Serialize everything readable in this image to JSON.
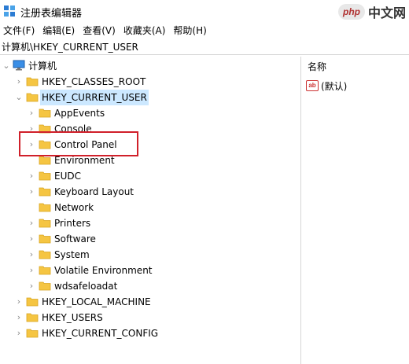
{
  "window": {
    "title": "注册表编辑器",
    "icon": "regedit-icon"
  },
  "watermark": {
    "badge": "php",
    "text": "中文网"
  },
  "menu": [
    {
      "label": "文件(F)"
    },
    {
      "label": "编辑(E)"
    },
    {
      "label": "查看(V)"
    },
    {
      "label": "收藏夹(A)"
    },
    {
      "label": "帮助(H)"
    }
  ],
  "address": "计算机\\HKEY_CURRENT_USER",
  "tree": {
    "root": {
      "label": "计算机",
      "expanded": true,
      "icon": "computer-icon"
    },
    "hives": [
      {
        "label": "HKEY_CLASSES_ROOT",
        "expanded": false
      },
      {
        "label": "HKEY_CURRENT_USER",
        "expanded": true,
        "selected": true,
        "children": [
          {
            "label": "AppEvents",
            "has_children": true
          },
          {
            "label": "Console",
            "has_children": true
          },
          {
            "label": "Control Panel",
            "has_children": true,
            "highlighted": true
          },
          {
            "label": "Environment",
            "has_children": false
          },
          {
            "label": "EUDC",
            "has_children": true
          },
          {
            "label": "Keyboard Layout",
            "has_children": true
          },
          {
            "label": "Network",
            "has_children": false
          },
          {
            "label": "Printers",
            "has_children": true
          },
          {
            "label": "Software",
            "has_children": true
          },
          {
            "label": "System",
            "has_children": true
          },
          {
            "label": "Volatile Environment",
            "has_children": true
          },
          {
            "label": "wdsafeloadat",
            "has_children": true
          }
        ]
      },
      {
        "label": "HKEY_LOCAL_MACHINE",
        "expanded": false
      },
      {
        "label": "HKEY_USERS",
        "expanded": false
      },
      {
        "label": "HKEY_CURRENT_CONFIG",
        "expanded": false
      }
    ]
  },
  "values_pane": {
    "column_name": "名称",
    "values": [
      {
        "name": "(默认)",
        "icon": "string-value-icon"
      }
    ]
  },
  "colors": {
    "selection": "#cce8ff",
    "highlight_box": "#d0202a",
    "folder": "#f5c542"
  }
}
